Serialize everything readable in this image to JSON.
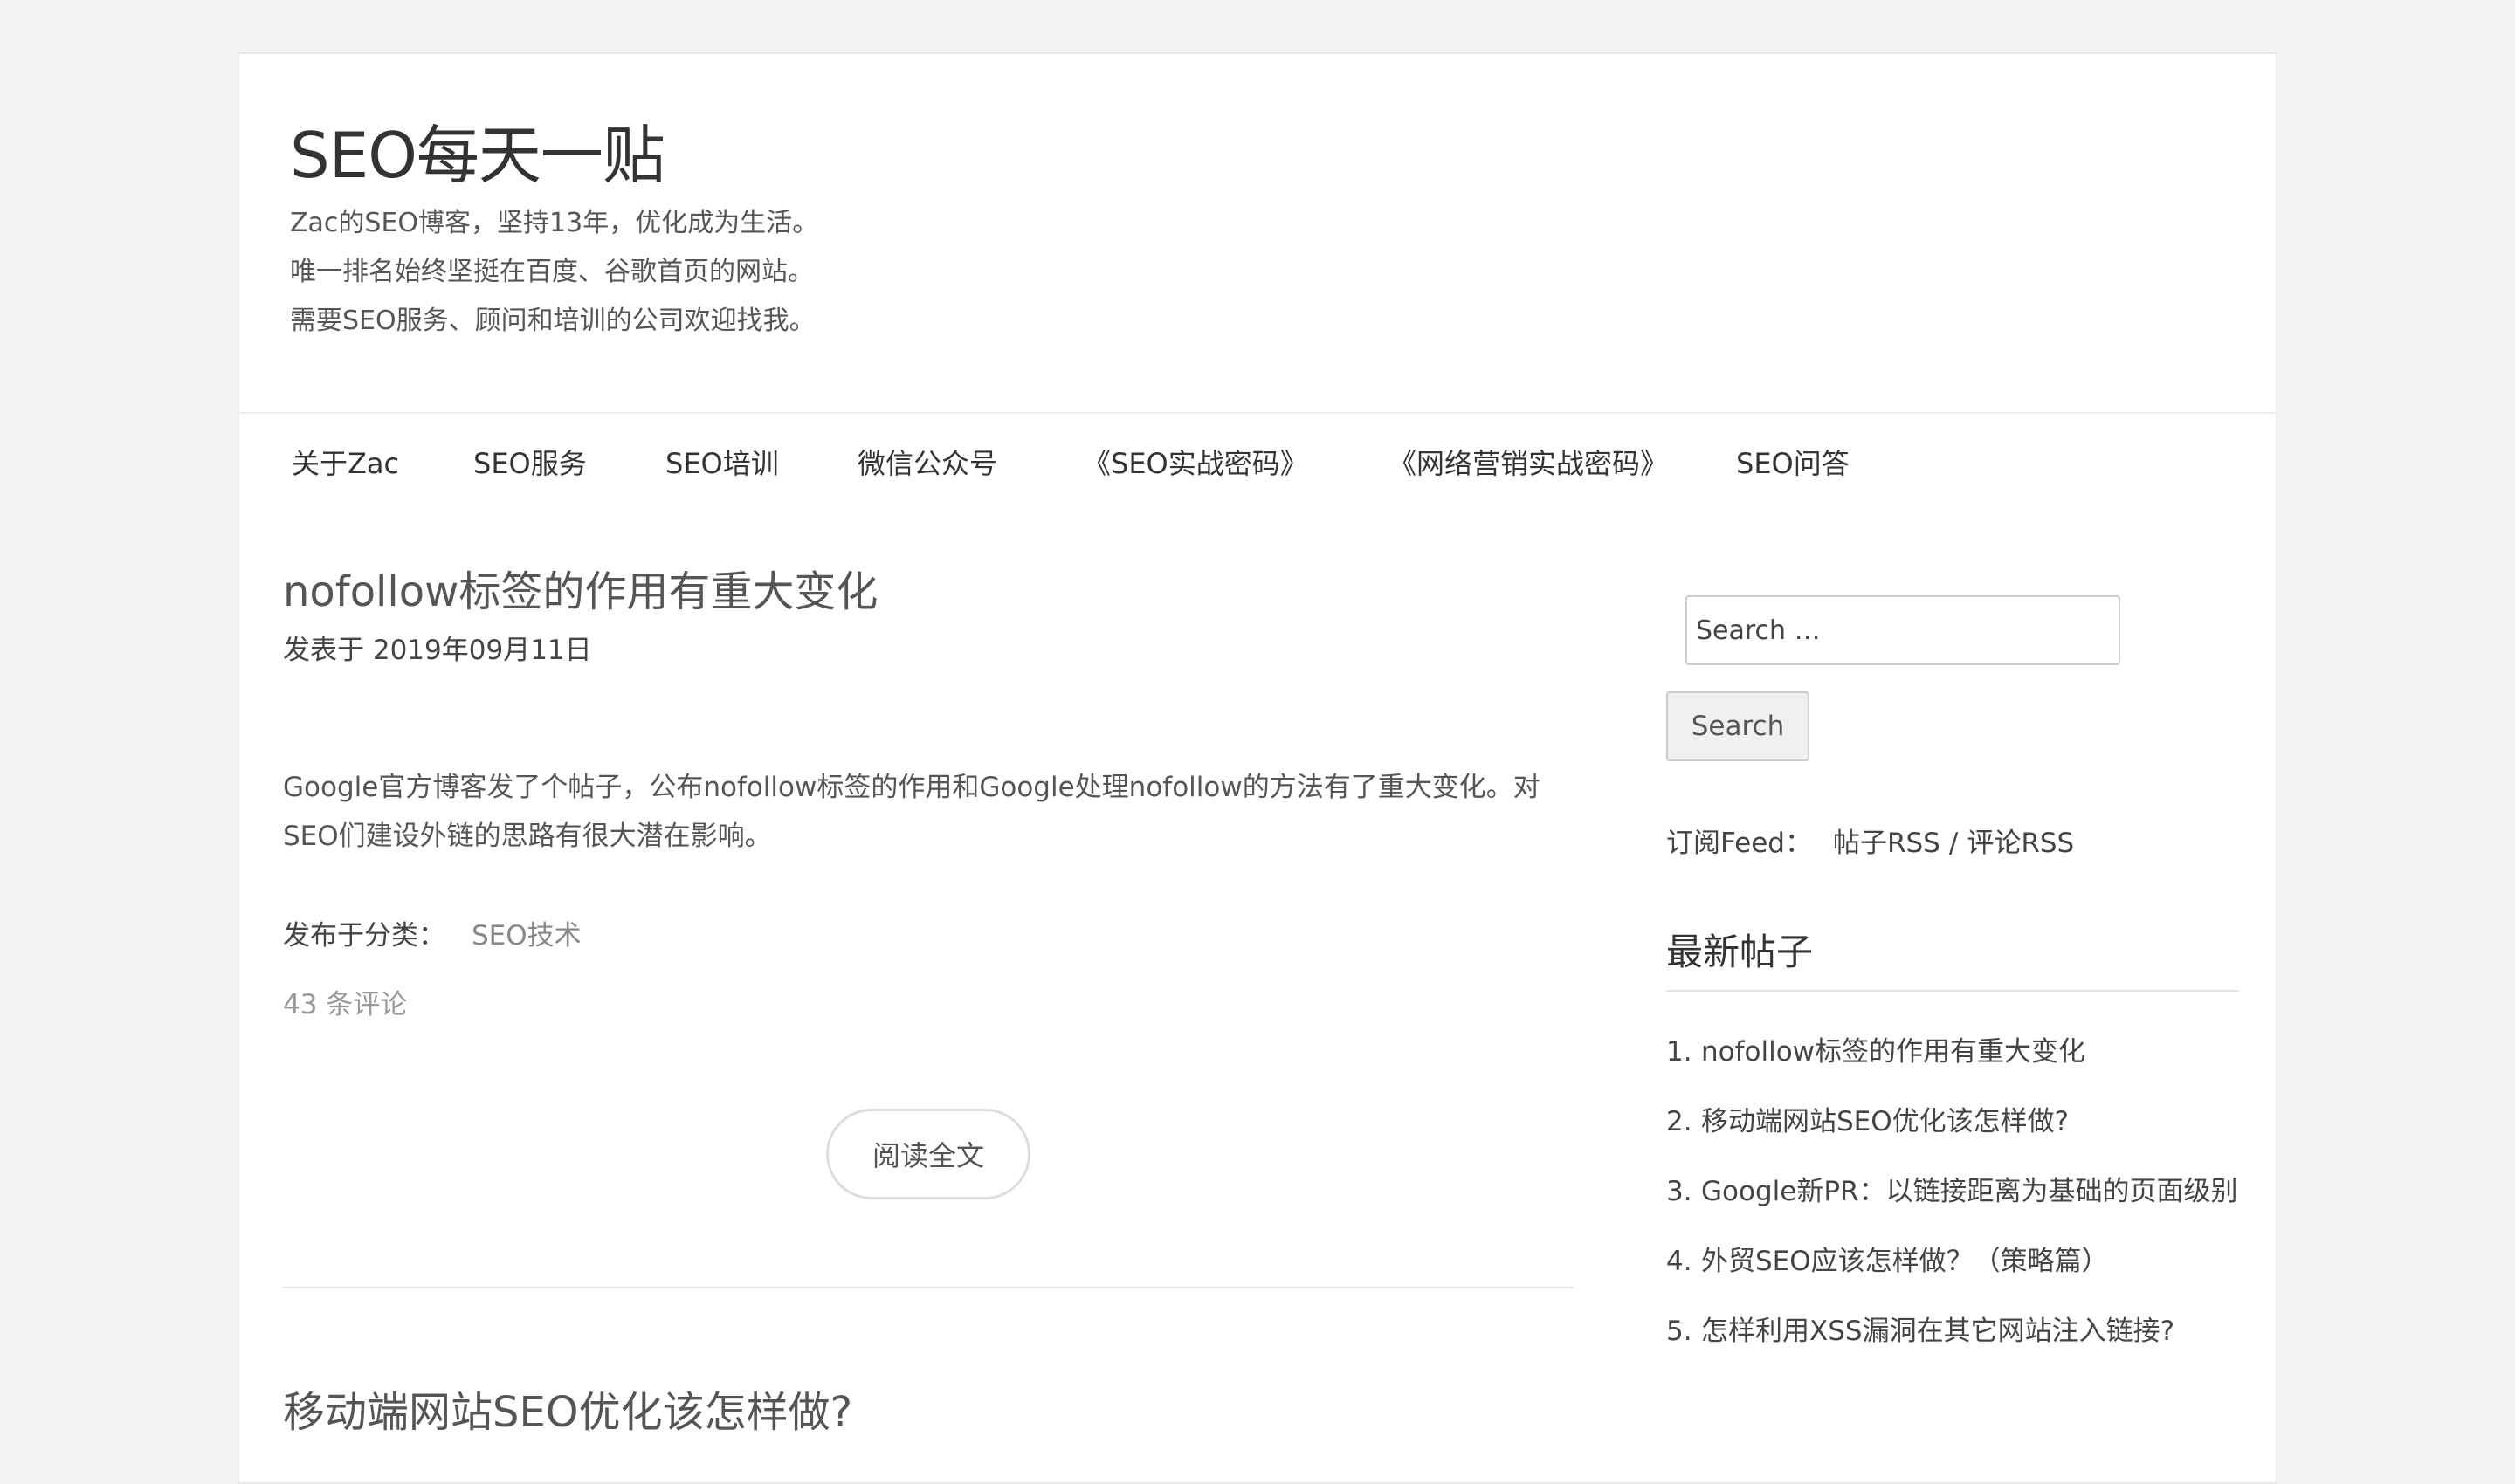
{
  "site": {
    "title": "SEO每天一贴",
    "taglines": [
      "Zac的SEO博客，坚持13年，优化成为生活。",
      "唯一排名始终坚挺在百度、谷歌首页的网站。",
      "需要SEO服务、顾问和培训的公司欢迎找我。"
    ]
  },
  "nav": {
    "items": [
      "关于Zac",
      "SEO服务",
      "SEO培训",
      "微信公众号",
      "《SEO实战密码》",
      "《网络营销实战密码》",
      "SEO问答"
    ]
  },
  "posts": [
    {
      "title": "nofollow标签的作用有重大变化",
      "meta": "发表于 2019年09月11日",
      "excerpt": "Google官方博客发了个帖子，公布nofollow标签的作用和Google处理nofollow的方法有了重大变化。对SEO们建设外链的思路有很大潜在影响。",
      "category_label": "发布于分类：",
      "category": "SEO技术",
      "comments": "43 条评论",
      "read_more": "阅读全文"
    },
    {
      "title": "移动端网站SEO优化该怎样做?"
    }
  ],
  "sidebar": {
    "search_placeholder": "Search …",
    "search_button": "Search",
    "feed_label": "订阅Feed：",
    "feed_posts": "帖子RSS",
    "feed_sep": "/",
    "feed_comments": "评论RSS",
    "recent_title": "最新帖子",
    "recent": [
      {
        "num": "1.",
        "title": "nofollow标签的作用有重大变化"
      },
      {
        "num": "2.",
        "title": "移动端网站SEO优化该怎样做?"
      },
      {
        "num": "3.",
        "title": "Google新PR：以链接距离为基础的页面级别"
      },
      {
        "num": "4.",
        "title": "外贸SEO应该怎样做？（策略篇）"
      },
      {
        "num": "5.",
        "title": "怎样利用XSS漏洞在其它网站注入链接?"
      }
    ]
  }
}
